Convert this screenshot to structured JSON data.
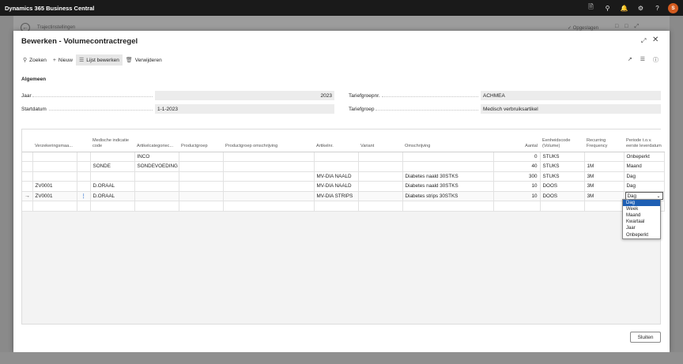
{
  "app": {
    "title": "Dynamics 365 Business Central",
    "avatar_initial": "S"
  },
  "topbar_icons": [
    "document-icon",
    "search-icon",
    "bell-icon",
    "gear-icon",
    "help-icon"
  ],
  "background": {
    "page_title": "Trajectinstellingen",
    "saved_status": "Opgeslagen"
  },
  "dialog": {
    "title": "Bewerken - Volumecontractregel",
    "toolbar": {
      "search": "Zoeken",
      "new": "Nieuw",
      "edit_list": "Lijst bewerken",
      "delete": "Verwijderen"
    },
    "section_title": "Algemeen",
    "fields": {
      "jaar_label": "Jaar",
      "jaar_value": "2023",
      "startdatum_label": "Startdatum",
      "startdatum_value": "1-1-2023",
      "tariefgroepnr_label": "Tariefgroepnr.",
      "tariefgroepnr_value": "ACHMEA",
      "tariefgroep_label": "Tariefgroep",
      "tariefgroep_value": "Medisch verbruiksartikel"
    },
    "close_label": "Sluiten"
  },
  "grid": {
    "columns": [
      "Verzekeringsmaa...",
      "Medische indicatie code",
      "Artikelcategoriec...",
      "Productgroep",
      "Productgroep omschrijving",
      "Artikelnr.",
      "Variant",
      "Omschrijving",
      "Aantal",
      "Eenheidscode (Volume)",
      "Recurring Frequency",
      "Periode t.o.v. eerste leverdatum"
    ],
    "rows": [
      {
        "verz": "",
        "med": "",
        "cat": "INCO",
        "pg": "",
        "pgo": "",
        "art": "",
        "var": "",
        "oms": "",
        "aantal": "0",
        "eenh": "STUKS",
        "freq": "",
        "periode": "Onbeperkt"
      },
      {
        "verz": "",
        "med": "SONDE",
        "cat": "SONDEVOEDING",
        "pg": "",
        "pgo": "",
        "art": "",
        "var": "",
        "oms": "",
        "aantal": "40",
        "eenh": "STUKS",
        "freq": "1M",
        "periode": "Maand"
      },
      {
        "verz": "",
        "med": "",
        "cat": "",
        "pg": "",
        "pgo": "",
        "art": "MV-DIA NAALD",
        "var": "",
        "oms": "Diabetes naald  30STKS",
        "aantal": "300",
        "eenh": "STUKS",
        "freq": "3M",
        "periode": "Dag"
      },
      {
        "verz": "ZV0001",
        "med": "D.ORAAL",
        "cat": "",
        "pg": "",
        "pgo": "",
        "art": "MV-DIA NAALD",
        "var": "",
        "oms": "Diabetes naald  30STKS",
        "aantal": "10",
        "eenh": "DOOS",
        "freq": "3M",
        "periode": "Dag"
      },
      {
        "verz": "ZV0001",
        "med": "D.ORAAL",
        "cat": "",
        "pg": "",
        "pgo": "",
        "art": "MV-DIA STRIPS",
        "var": "",
        "oms": "Diabetes strips  30STKS",
        "aantal": "10",
        "eenh": "DOOS",
        "freq": "3M",
        "periode": "Dag"
      }
    ],
    "dropdown_options": [
      "Dag",
      "Week",
      "Maand",
      "Kwartaal",
      "Jaar",
      "Onbeperkt"
    ],
    "dropdown_selected": "Dag"
  }
}
